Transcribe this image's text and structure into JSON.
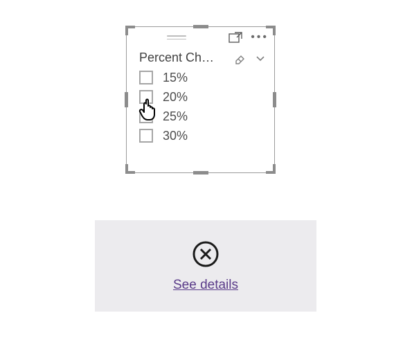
{
  "slicer": {
    "title": "Percent Ch…",
    "items": [
      {
        "label": "15%",
        "checked": false
      },
      {
        "label": "20%",
        "checked": false
      },
      {
        "label": "25%",
        "checked": false
      },
      {
        "label": "30%",
        "checked": false
      }
    ]
  },
  "error": {
    "details_link": "See details"
  },
  "colors": {
    "handle": "#8c8c8c",
    "link": "#5a3b89",
    "error_bg": "#ecebee"
  }
}
